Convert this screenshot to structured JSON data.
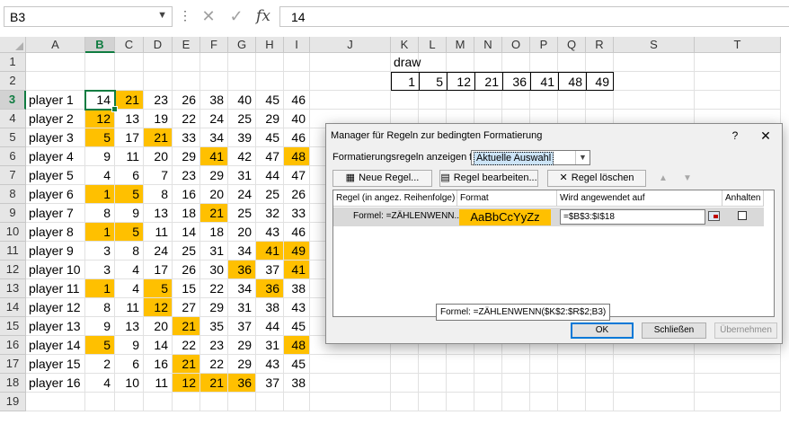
{
  "formula_bar": {
    "name_box": "B3",
    "dots": "⋮",
    "cancel_glyph": "✕",
    "enter_glyph": "✓",
    "fx": "fx",
    "formula": "14"
  },
  "columns": [
    "A",
    "B",
    "C",
    "D",
    "E",
    "F",
    "G",
    "H",
    "I",
    "J",
    "K",
    "L",
    "M",
    "N",
    "O",
    "P",
    "Q",
    "R",
    "S",
    "T"
  ],
  "selected_column": "B",
  "selected_row": "3",
  "draw_label": "draw",
  "draw_values": [
    "1",
    "5",
    "12",
    "21",
    "36",
    "41",
    "48",
    "49"
  ],
  "players": [
    {
      "name": "player 1",
      "values": [
        "14",
        "21",
        "23",
        "26",
        "38",
        "40",
        "45",
        "46"
      ]
    },
    {
      "name": "player 2",
      "values": [
        "12",
        "13",
        "19",
        "22",
        "24",
        "25",
        "29",
        "40"
      ]
    },
    {
      "name": "player 3",
      "values": [
        "5",
        "17",
        "21",
        "33",
        "34",
        "39",
        "45",
        "46"
      ]
    },
    {
      "name": "player 4",
      "values": [
        "9",
        "11",
        "20",
        "29",
        "41",
        "42",
        "47",
        "48"
      ]
    },
    {
      "name": "player 5",
      "values": [
        "4",
        "6",
        "7",
        "23",
        "29",
        "31",
        "44",
        "47"
      ]
    },
    {
      "name": "player 6",
      "values": [
        "1",
        "5",
        "8",
        "16",
        "20",
        "24",
        "25",
        "26"
      ]
    },
    {
      "name": "player 7",
      "values": [
        "8",
        "9",
        "13",
        "18",
        "21",
        "25",
        "32",
        "33"
      ]
    },
    {
      "name": "player 8",
      "values": [
        "1",
        "5",
        "11",
        "14",
        "18",
        "20",
        "43",
        "46"
      ]
    },
    {
      "name": "player 9",
      "values": [
        "3",
        "8",
        "24",
        "25",
        "31",
        "34",
        "41",
        "49"
      ]
    },
    {
      "name": "player 10",
      "values": [
        "3",
        "4",
        "17",
        "26",
        "30",
        "36",
        "37",
        "41"
      ]
    },
    {
      "name": "player 11",
      "values": [
        "1",
        "4",
        "5",
        "15",
        "22",
        "34",
        "36",
        "38"
      ]
    },
    {
      "name": "player 12",
      "values": [
        "8",
        "11",
        "12",
        "27",
        "29",
        "31",
        "38",
        "43"
      ]
    },
    {
      "name": "player 13",
      "values": [
        "9",
        "13",
        "20",
        "21",
        "35",
        "37",
        "44",
        "45"
      ]
    },
    {
      "name": "player 14",
      "values": [
        "5",
        "9",
        "14",
        "22",
        "23",
        "29",
        "31",
        "48"
      ]
    },
    {
      "name": "player 15",
      "values": [
        "2",
        "6",
        "16",
        "21",
        "22",
        "29",
        "43",
        "45"
      ]
    },
    {
      "name": "player 16",
      "values": [
        "4",
        "10",
        "11",
        "12",
        "21",
        "36",
        "37",
        "38"
      ]
    }
  ],
  "highlight_color": "#ffc000",
  "accent_color": "#107c41",
  "dialog": {
    "title": "Manager für Regeln zur bedingten Formatierung",
    "help": "?",
    "close": "✕",
    "show_label": "Formatierungsregeln anzeigen für:",
    "show_value": "Aktuelle Auswahl",
    "new_rule": "Neue Regel...",
    "edit_rule": "Regel bearbeiten...",
    "delete_rule": "Regel löschen",
    "col_rule": "Regel (in angez. Reihenfolge)",
    "col_format": "Format",
    "col_applies": "Wird angewendet auf",
    "col_stop": "Anhalten",
    "rule_text": "Formel: =ZÄHLENWENN...",
    "format_preview": "AaBbCcYyZz",
    "applies_to": "=$B$3:$I$18",
    "tooltip": "Formel: =ZÄHLENWENN($K$2:$R$2;B3)",
    "ok": "OK",
    "close_btn": "Schließen",
    "apply": "Übernehmen"
  }
}
